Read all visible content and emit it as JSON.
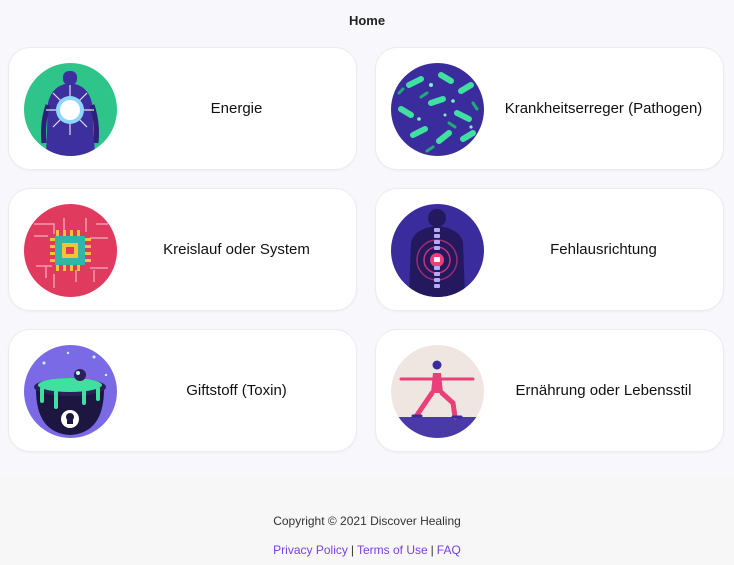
{
  "header": {
    "title": "Home"
  },
  "cards": [
    {
      "label": "Energie",
      "icon": "energy-body-icon"
    },
    {
      "label": "Krankheitserreger (Pathogen)",
      "icon": "pathogen-bacteria-icon"
    },
    {
      "label": "Kreislauf oder System",
      "icon": "circuit-chip-icon"
    },
    {
      "label": "Fehlausrichtung",
      "icon": "spine-misalignment-icon"
    },
    {
      "label": "Giftstoff (Toxin)",
      "icon": "toxin-cauldron-icon"
    },
    {
      "label": "Ernährung oder Lebensstil",
      "icon": "yoga-lifestyle-icon"
    }
  ],
  "footer": {
    "copyright": "Copyright © 2021 Discover Healing",
    "links": [
      "Privacy Policy",
      "Terms of Use",
      "FAQ"
    ],
    "separator": "|"
  },
  "colors": {
    "link": "#7b3fe0",
    "background": "#f8f7fb",
    "card": "#ffffff"
  }
}
